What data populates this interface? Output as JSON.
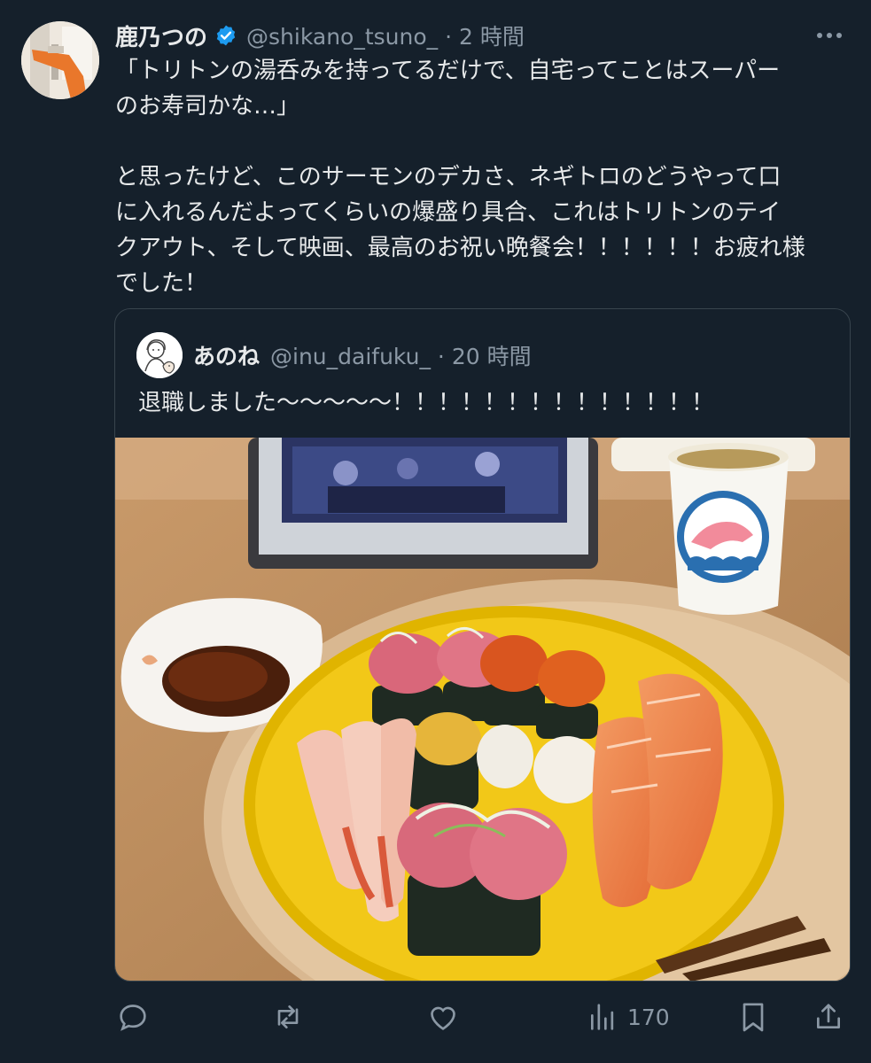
{
  "tweet": {
    "author_name": "鹿乃つの",
    "handle_time": "@shikano_tsuno_ · 2 時間",
    "text": "「トリトンの湯呑みを持ってるだけで、自宅ってことはスーパー\nのお寿司かな…」\n\nと思ったけど、このサーモンのデカさ、ネギトロのどうやって口\nに入れるんだよってくらいの爆盛り具合、これはトリトンのテイ\nクアウト、そして映画、最高のお祝い晩餐会！！！！！！お疲れ様\nでした！",
    "verified_icon": "verified-badge-icon",
    "more_icon": "more-dots-icon"
  },
  "quote": {
    "author_name": "あのね",
    "handle_time": "@inu_daifuku_ · 20 時間",
    "text": "退職しました〜〜〜〜〜！！！！！！！！！！！！！！"
  },
  "actions": {
    "reply_icon": "reply-icon",
    "retweet_icon": "retweet-icon",
    "like_icon": "heart-icon",
    "views_icon": "views-chart-icon",
    "views_count": "170",
    "bookmark_icon": "bookmark-icon",
    "share_icon": "share-icon"
  },
  "colors": {
    "background": "#15202b",
    "text_primary": "#e7e9ea",
    "text_secondary": "#8b98a5",
    "verified_blue": "#1d9bf0",
    "border": "#38444d"
  }
}
